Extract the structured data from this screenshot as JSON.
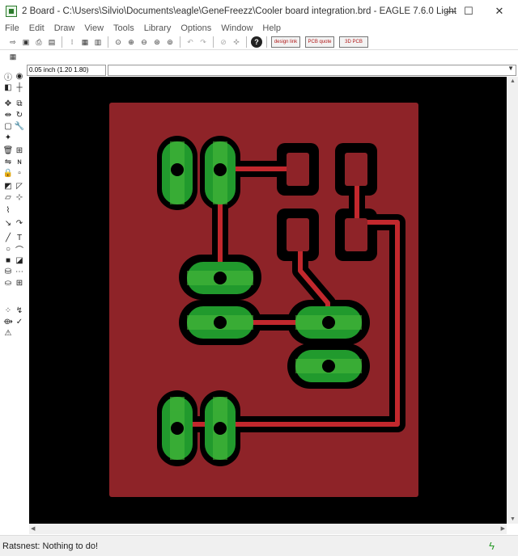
{
  "window": {
    "title": "2 Board - C:\\Users\\Silvio\\Documents\\eagle\\GeneFreezz\\Cooler board integration.brd - EAGLE 7.6.0 Light",
    "min_glyph": "—",
    "max_glyph": "☐",
    "close_glyph": "✕"
  },
  "menu": [
    "File",
    "Edit",
    "Draw",
    "View",
    "Tools",
    "Library",
    "Options",
    "Window",
    "Help"
  ],
  "toolbar": {
    "ulp_buttons": [
      "design link",
      "PCB quote",
      "3D PCB"
    ]
  },
  "coords": {
    "grid_readout": "0.05 inch (1.20 1.80)"
  },
  "status": {
    "message": "Ratsnest: Nothing to do!"
  },
  "colors": {
    "board": "#8e2328",
    "pad": "#219a2d",
    "background": "#000000",
    "trace": "#c2282d"
  }
}
